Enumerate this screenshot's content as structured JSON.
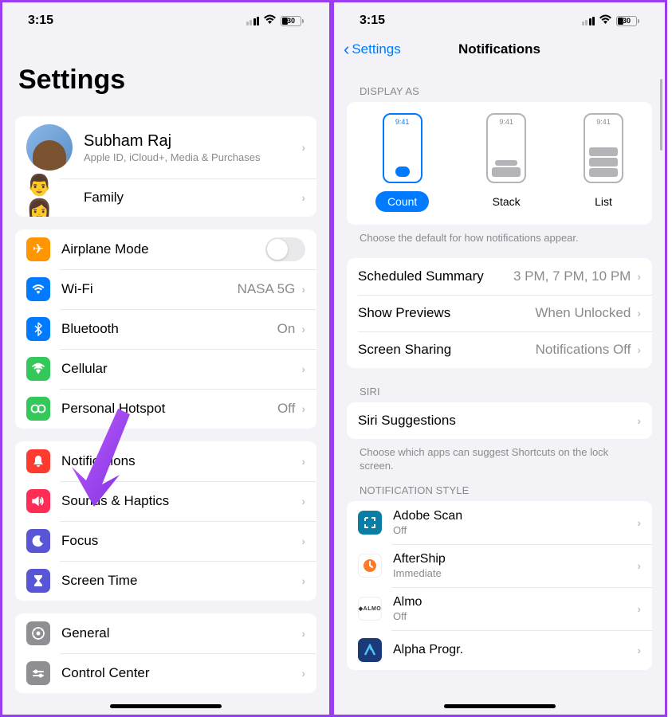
{
  "status": {
    "time": "3:15",
    "battery_pct": "30"
  },
  "left": {
    "title": "Settings",
    "profile": {
      "name": "Subham Raj",
      "subtitle": "Apple ID, iCloud+, Media & Purchases"
    },
    "family": {
      "label": "Family"
    },
    "network": {
      "airplane": "Airplane Mode",
      "wifi": {
        "label": "Wi-Fi",
        "value": "NASA 5G"
      },
      "bluetooth": {
        "label": "Bluetooth",
        "value": "On"
      },
      "cellular": {
        "label": "Cellular"
      },
      "hotspot": {
        "label": "Personal Hotspot",
        "value": "Off"
      }
    },
    "attention": {
      "notifications": "Notifications",
      "sounds": "Sounds & Haptics",
      "focus": "Focus",
      "screen_time": "Screen Time"
    },
    "system": {
      "general": "General",
      "control_center": "Control Center"
    }
  },
  "right": {
    "back_label": "Settings",
    "title": "Notifications",
    "display_as_header": "DISPLAY AS",
    "display_time": "9:41",
    "display_opts": {
      "count": "Count",
      "stack": "Stack",
      "list": "List"
    },
    "display_footer": "Choose the default for how notifications appear.",
    "rows": {
      "scheduled": {
        "label": "Scheduled Summary",
        "value": "3 PM, 7 PM, 10 PM"
      },
      "previews": {
        "label": "Show Previews",
        "value": "When Unlocked"
      },
      "sharing": {
        "label": "Screen Sharing",
        "value": "Notifications Off"
      }
    },
    "siri_header": "SIRI",
    "siri_row": "Siri Suggestions",
    "siri_footer": "Choose which apps can suggest Shortcuts on the lock screen.",
    "style_header": "NOTIFICATION STYLE",
    "apps": {
      "adobe": {
        "name": "Adobe Scan",
        "sub": "Off"
      },
      "aftership": {
        "name": "AfterShip",
        "sub": "Immediate"
      },
      "almo": {
        "name": "Almo",
        "sub": "Off"
      },
      "alpha": {
        "name": "Alpha Progr."
      }
    }
  }
}
